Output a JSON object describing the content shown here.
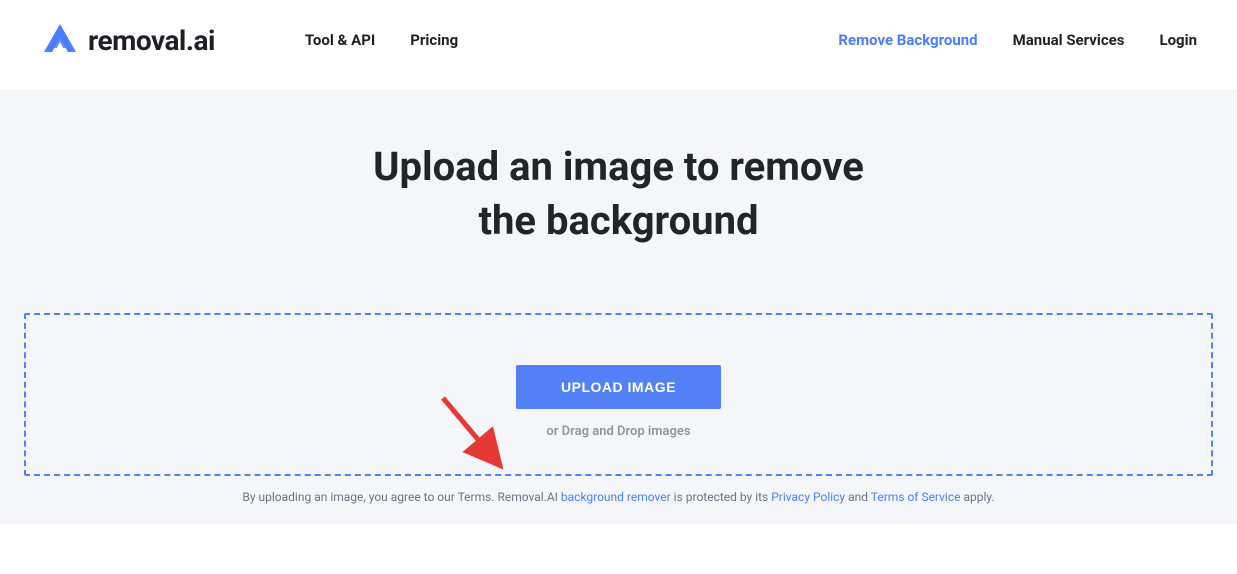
{
  "brand": {
    "name": "removal.ai"
  },
  "nav": {
    "left": [
      {
        "label": "Tool & API"
      },
      {
        "label": "Pricing"
      }
    ],
    "right": [
      {
        "label": "Remove Background",
        "active": true
      },
      {
        "label": "Manual Services"
      },
      {
        "label": "Login"
      }
    ]
  },
  "hero": {
    "title_line1": "Upload an image to remove",
    "title_line2": "the background"
  },
  "upload": {
    "button_label": "UPLOAD IMAGE",
    "drag_text": "or Drag and Drop images"
  },
  "terms": {
    "prefix": "By uploading an image, you agree to our Terms. Removal.AI ",
    "link_bg_remover": "background remover",
    "mid1": " is protected by its ",
    "link_privacy": "Privacy Policy",
    "mid2": " and ",
    "link_tos": "Terms of Service",
    "suffix": " apply."
  },
  "annotation": {
    "arrow": "red-arrow"
  }
}
